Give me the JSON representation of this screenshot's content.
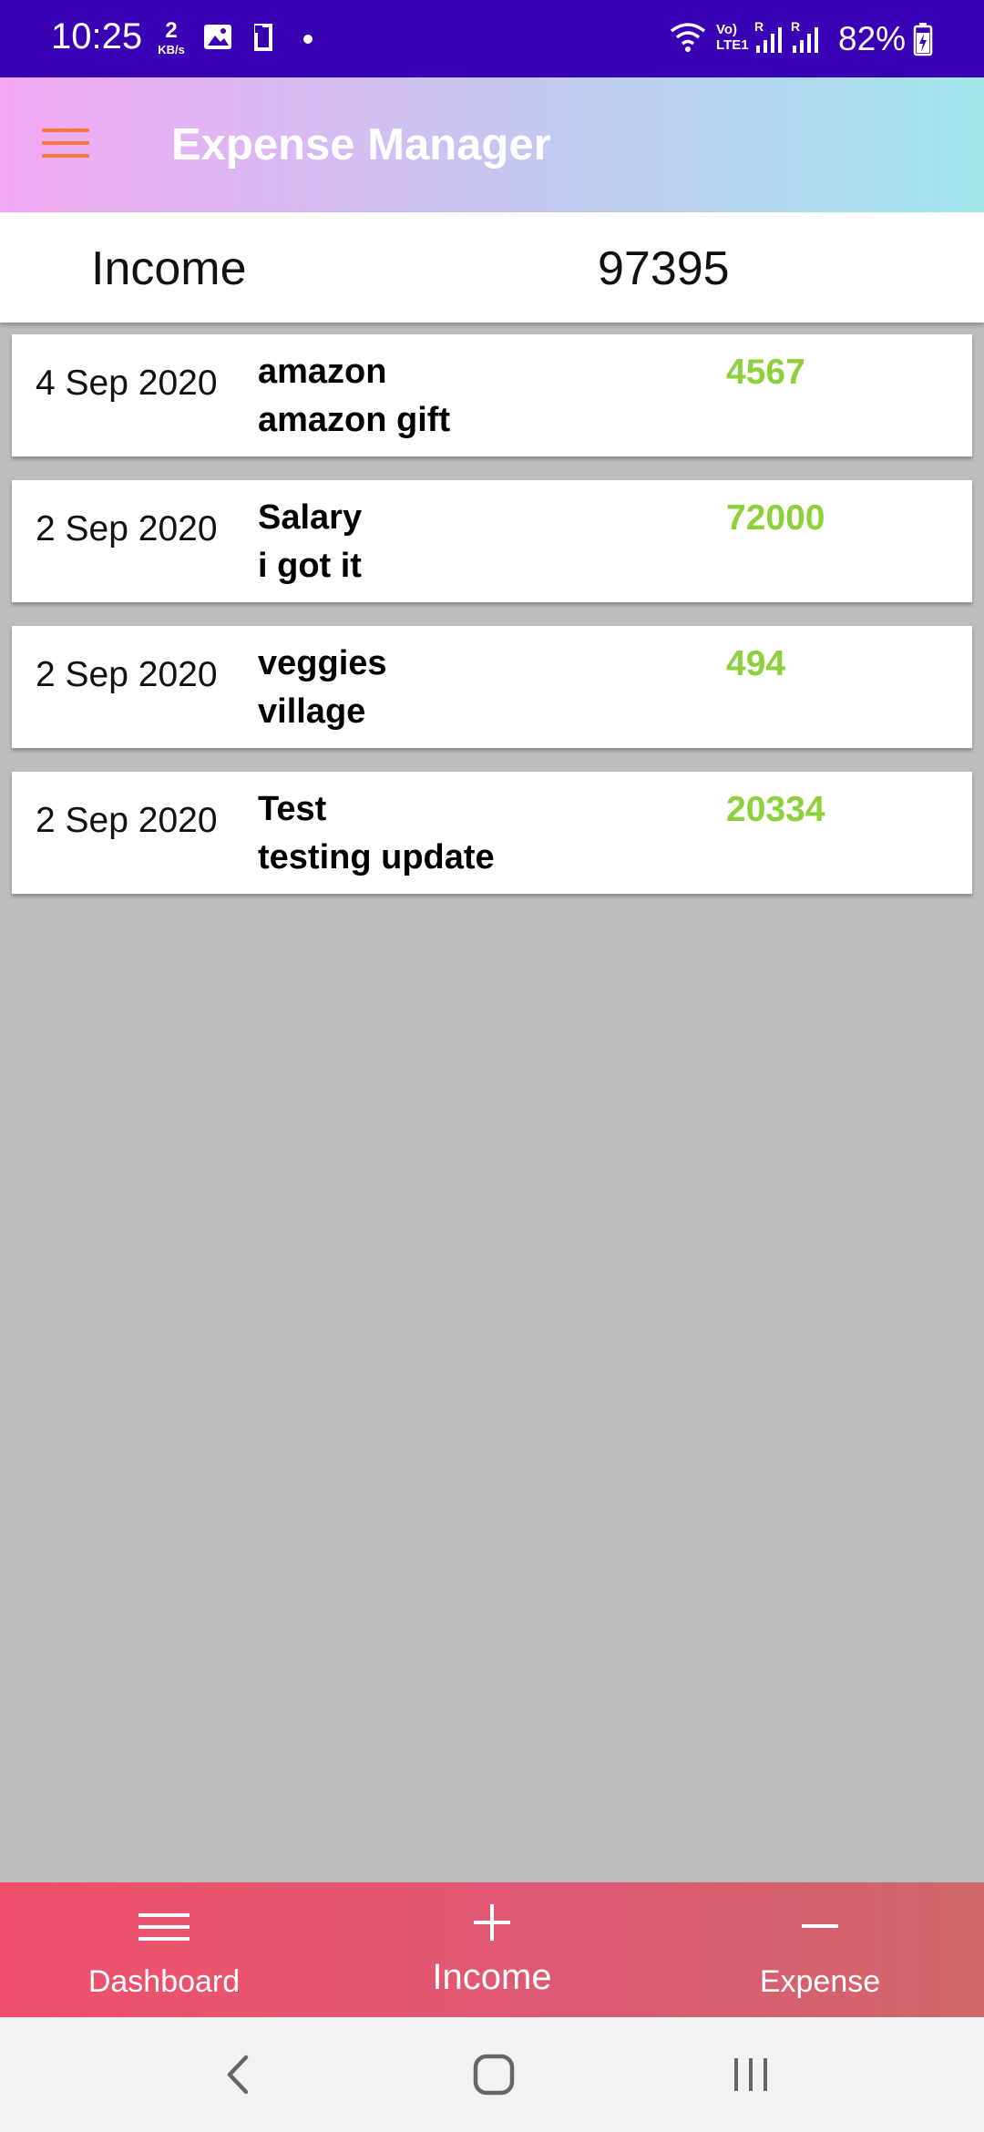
{
  "status_bar": {
    "time": "10:25",
    "data_speed_value": "2",
    "data_speed_unit": "KB/s",
    "network_label_1": "Vo)",
    "network_label_2": "LTE1",
    "battery": "82%",
    "icons": [
      "gallery-icon",
      "app-icon",
      "dot-icon",
      "wifi-icon",
      "signal-icon",
      "signal-icon",
      "battery-charging-icon"
    ]
  },
  "app_bar": {
    "title": "Expense Manager",
    "menu_icon": "hamburger-menu-icon",
    "menu_color": "#f07a3c"
  },
  "summary": {
    "label": "Income",
    "value": "97395"
  },
  "income_list": [
    {
      "date": "4 Sep 2020",
      "title": "amazon",
      "description": "amazon gift",
      "amount": "4567"
    },
    {
      "date": "2 Sep 2020",
      "title": "Salary",
      "description": "i got it",
      "amount": "72000"
    },
    {
      "date": "2 Sep 2020",
      "title": "veggies",
      "description": "village",
      "amount": "494"
    },
    {
      "date": "2 Sep 2020",
      "title": "Test",
      "description": "testing update",
      "amount": "20334"
    }
  ],
  "bottom_nav": {
    "items": [
      {
        "label": "Dashboard",
        "icon": "menu-lines-icon"
      },
      {
        "label": "Income",
        "icon": "plus-icon"
      },
      {
        "label": "Expense",
        "icon": "minus-icon"
      }
    ]
  },
  "colors": {
    "status_bar": "#3a00b3",
    "amount": "#8dd13a",
    "bottom_nav": "#ef4f6c",
    "background": "#bdbdbd"
  }
}
